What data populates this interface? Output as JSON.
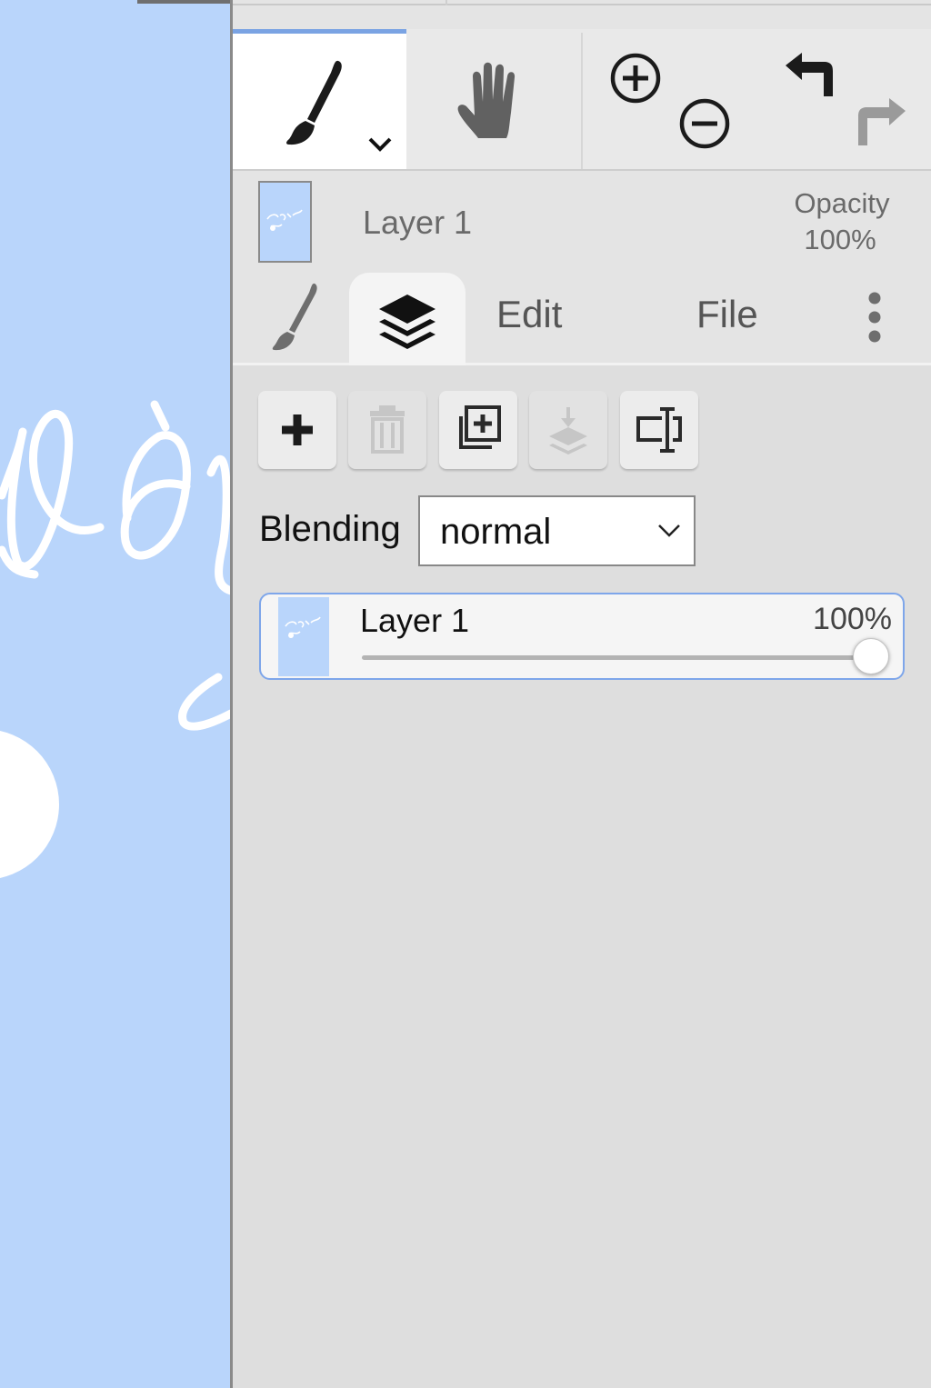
{
  "canvas": {
    "background_color": "#b9d5fb"
  },
  "toolbar": {
    "tools": [
      {
        "name": "brush-tool",
        "icon": "paintbrush-icon",
        "active": true
      },
      {
        "name": "hand-tool",
        "icon": "hand-icon",
        "active": false
      }
    ],
    "actions": [
      "zoom-in-icon",
      "zoom-out-icon",
      "undo-icon",
      "redo-icon"
    ],
    "accent_color": "#7aa3e3"
  },
  "layer_info": {
    "name": "Layer 1",
    "opacity_label": "Opacity",
    "opacity_value": "100%"
  },
  "tabs": {
    "brush_icon": "paintbrush-icon",
    "layers_icon": "layers-icon",
    "edit": "Edit",
    "file": "File",
    "more_icon": "more-vertical-icon",
    "active": "layers"
  },
  "layer_actions": [
    {
      "icon": "plus-icon",
      "enabled": true
    },
    {
      "icon": "trash-icon",
      "enabled": false
    },
    {
      "icon": "duplicate-layer-icon",
      "enabled": true
    },
    {
      "icon": "merge-down-icon",
      "enabled": false
    },
    {
      "icon": "rename-icon",
      "enabled": true
    }
  ],
  "blending": {
    "label": "Blending",
    "value": "normal"
  },
  "layers": [
    {
      "name": "Layer 1",
      "opacity": "100%",
      "opacity_fraction": 1.0,
      "selected": true
    }
  ]
}
